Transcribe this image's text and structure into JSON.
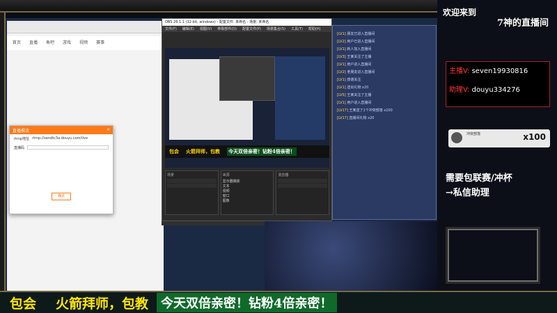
{
  "welcome": {
    "line1": "欢迎来到",
    "line2": "7神的直播间"
  },
  "host": {
    "streamer_label": "主播V:",
    "streamer_id": "seven19930816",
    "assistant_label": "助理V:",
    "assistant_id": "douyu334276"
  },
  "gift": {
    "text": "冲突部落",
    "count": "x100"
  },
  "promo": {
    "line1": "需要包联赛/冲杯",
    "line2": "→私信助理"
  },
  "banner": {
    "part1": "包会",
    "part2": "火箭拜师，包教",
    "part3": "今天双倍亲密！钻粉4倍亲密！"
  },
  "obs": {
    "title": "OBS 26.1.1 (32-bit, windows) - 配置文件: 未命名 - 场景: 未命名",
    "menus": [
      "文件(F)",
      "编辑(E)",
      "视图(V)",
      "停靠部件(D)",
      "配置文件(P)",
      "场景集合(S)",
      "工具(T)",
      "帮助(H)"
    ],
    "docks": [
      "场景",
      "来源",
      "混音器"
    ],
    "sources": [
      "显示器捕获",
      "文本",
      "视频",
      "窗口",
      "图像"
    ],
    "preview_banner": {
      "part1": "包会",
      "part2": "火箭拜师，包教",
      "part3": "今天双倍亲密！钻粉4倍亲密！"
    }
  },
  "browser": {
    "tabs": [
      "首页",
      "直播",
      "鱼吧",
      "游戏",
      "视频",
      "赛事"
    ]
  },
  "dialog": {
    "title": "直播推流",
    "rtmp_label": "rtmp地址",
    "rtmp_value": "rtmp://sendtc3a.douyu.com/live",
    "code_label": "直播码",
    "ok_label": "确定"
  },
  "chat": [
    {
      "lv": "[LV1]",
      "text": "朋友已进入直播间"
    },
    {
      "lv": "[LV2]",
      "text": "用户已进入直播间"
    },
    {
      "lv": "[LV1]",
      "text": "新人加入直播间"
    },
    {
      "lv": "[LV3]",
      "text": "王某关注了主播"
    },
    {
      "lv": "[LV1]",
      "text": "用户进入直播间"
    },
    {
      "lv": "[LV2]",
      "text": "老朋友进入直播间"
    },
    {
      "lv": "[LV1]",
      "text": "感谢关注"
    },
    {
      "lv": "[LV1]",
      "text": "送出礼物 x20"
    },
    {
      "lv": "[LV5]",
      "text": "王某关注了主播"
    },
    {
      "lv": "[LV1]",
      "text": "用户进入直播间"
    },
    {
      "lv": "[LV17]",
      "text": "王某送了1个冲突部落 x100"
    },
    {
      "lv": "[LV17]",
      "text": "直播间礼物 x20"
    }
  ]
}
